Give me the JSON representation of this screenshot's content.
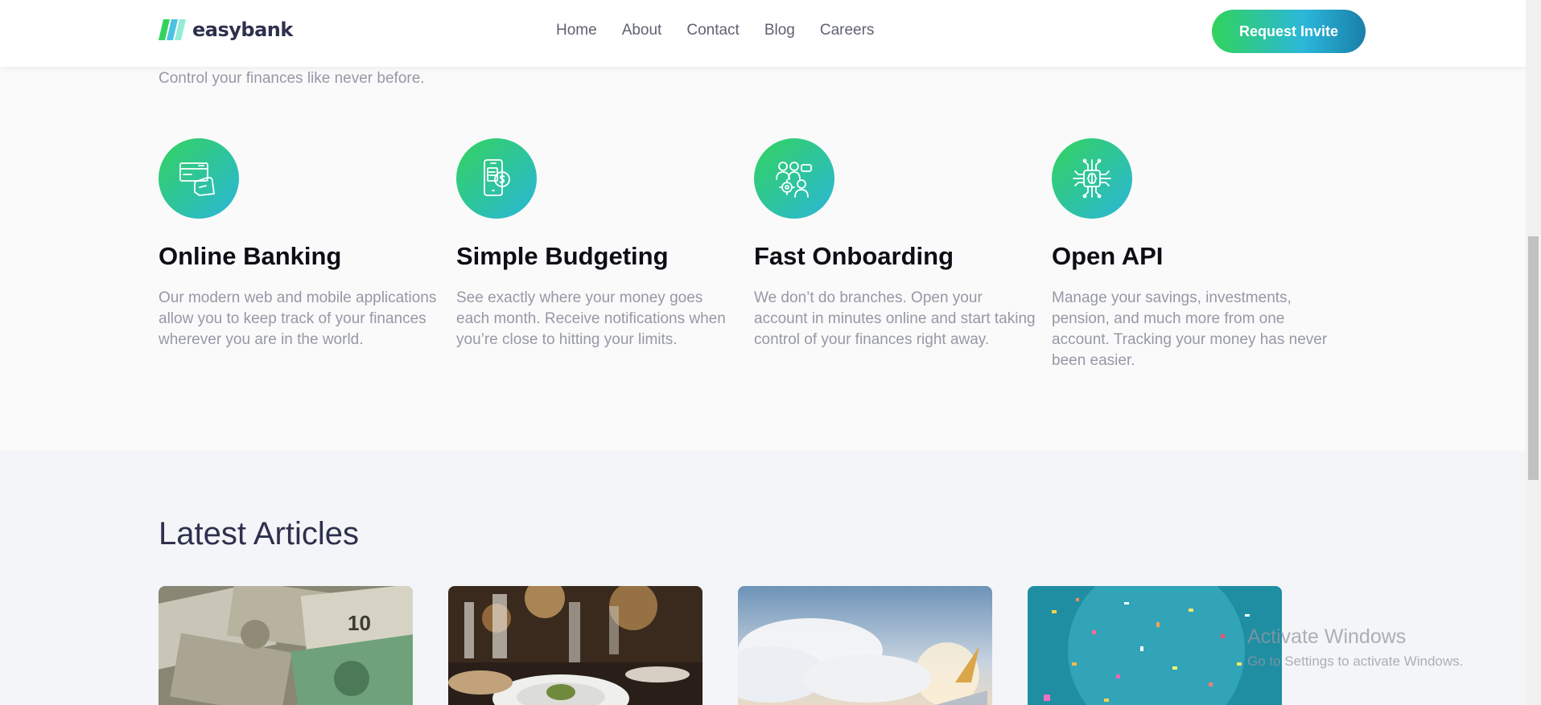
{
  "header": {
    "logo_text": "easybank",
    "nav": [
      "Home",
      "About",
      "Contact",
      "Blog",
      "Careers"
    ],
    "cta_label": "Request Invite"
  },
  "features": {
    "intro": "Control your finances like never before.",
    "items": [
      {
        "icon": "credit-card-hand-icon",
        "title": "Online Banking",
        "text": "Our modern web and mobile applications allow you to keep track of your finances wherever you are in the world."
      },
      {
        "icon": "phone-dollar-icon",
        "title": "Simple Budgeting",
        "text": "See exactly where your money goes each month. Receive notifications when you’re close to hitting your limits."
      },
      {
        "icon": "people-gear-icon",
        "title": "Fast Onboarding",
        "text": "We don’t do branches. Open your account in minutes online and start taking control of your finances right away."
      },
      {
        "icon": "circuit-chip-icon",
        "title": "Open API",
        "text": "Manage your savings, investments, pension, and much more from one account. Tracking your money has never been easier."
      }
    ]
  },
  "articles": {
    "heading": "Latest Articles",
    "cards": [
      {
        "image": "currency-notes-image"
      },
      {
        "image": "restaurant-dinner-image"
      },
      {
        "image": "airplane-clouds-image"
      },
      {
        "image": "confetti-image"
      }
    ]
  },
  "watermark": {
    "title": "Activate Windows",
    "subtitle": "Go to Settings to activate Windows."
  },
  "colors": {
    "accent_green": "#31d35c",
    "accent_cyan": "#2bb7da",
    "dark_text": "#2d314d",
    "muted_text": "#9698a6"
  }
}
